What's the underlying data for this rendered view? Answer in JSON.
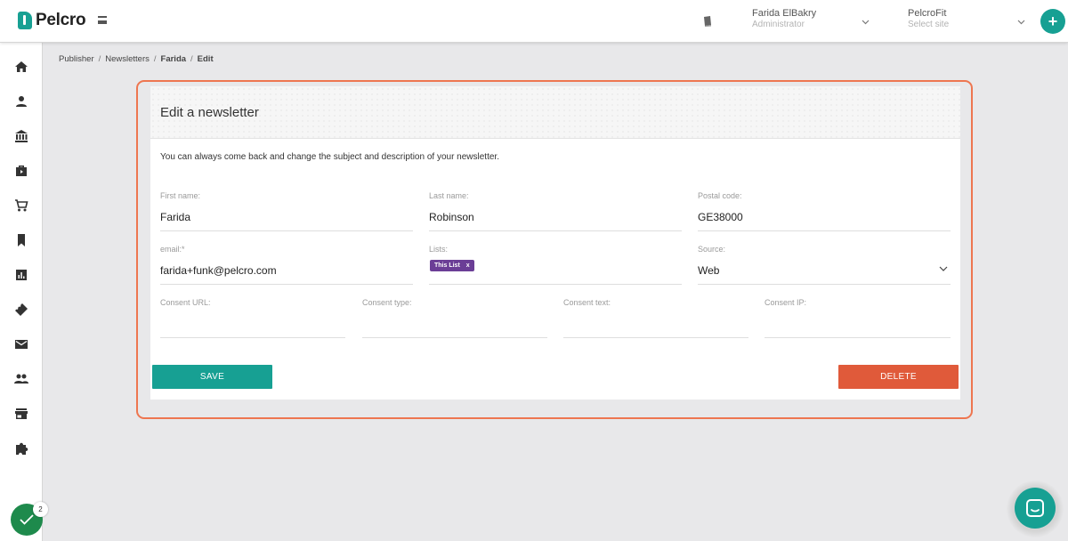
{
  "brand": {
    "name": "Pelcro",
    "color": "#17a093"
  },
  "header": {
    "user_name": "Farida ElBakry",
    "user_role": "Administrator",
    "site_name": "PelcroFit",
    "site_placeholder": "Select site",
    "add_label": "+"
  },
  "sidebar": {
    "items": [
      "home-icon",
      "person-icon",
      "bank-icon",
      "wallet-icon",
      "cart-icon",
      "bookmark-icon",
      "chart-icon",
      "ticket-icon",
      "mail-icon",
      "group-icon",
      "store-icon",
      "puzzle-icon"
    ],
    "tasks_count": "2"
  },
  "breadcrumb": [
    {
      "label": "Publisher"
    },
    {
      "label": "Newsletters"
    },
    {
      "label": "Farida"
    },
    {
      "label": "Edit"
    }
  ],
  "form": {
    "title": "Edit a newsletter",
    "description": "You can always come back and change the subject and description of your newsletter.",
    "first_name": {
      "label": "First name:",
      "value": "Farida"
    },
    "last_name": {
      "label": "Last name:",
      "value": "Robinson"
    },
    "postal_code": {
      "label": "Postal code:",
      "value": "GE38000"
    },
    "email": {
      "label": "email:*",
      "value": "farida+funk@pelcro.com"
    },
    "lists": {
      "label": "Lists:",
      "chip": "This List",
      "chip_remove": "x",
      "chip_color": "#6b3e96"
    },
    "source": {
      "label": "Source:",
      "value": "Web"
    },
    "consent_url": {
      "label": "Consent URL:",
      "value": ""
    },
    "consent_type": {
      "label": "Consent type:",
      "value": ""
    },
    "consent_text": {
      "label": "Consent text:",
      "value": ""
    },
    "consent_ip": {
      "label": "Consent IP:",
      "value": ""
    },
    "save_label": "SAVE",
    "delete_label": "DELETE",
    "save_color": "#17a093",
    "delete_color": "#e05a3a",
    "highlight_color": "#ee7650"
  }
}
